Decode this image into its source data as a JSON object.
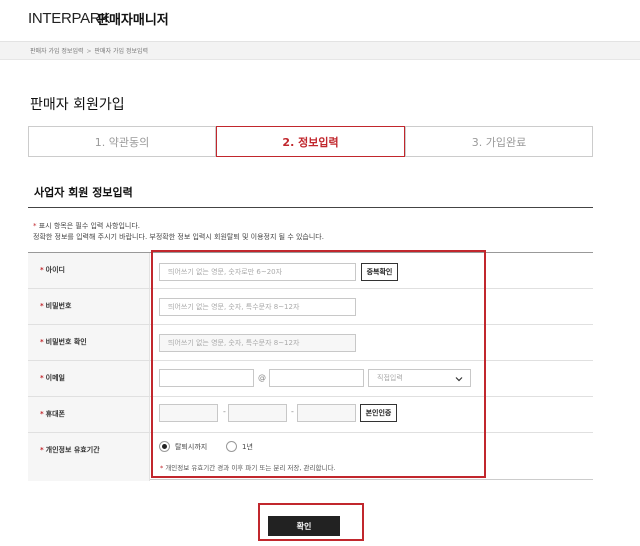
{
  "header": {
    "brand": "INTERPARK",
    "subtitle": "판매자매니저"
  },
  "breadcrumb": {
    "items": [
      "판매자 가입 정보입력",
      "판매자 가입 정보입력"
    ],
    "separator": ">"
  },
  "page": {
    "title": "판매자 회원가입"
  },
  "steps": [
    {
      "label": "1. 약관동의",
      "active": false
    },
    {
      "label": "2. 정보입력",
      "active": true
    },
    {
      "label": "3. 가입완료",
      "active": false
    }
  ],
  "section": {
    "title": "사업자 회원 정보입력"
  },
  "notice": {
    "star": "*",
    "line1": "표시 항목은 필수 입력 사항입니다.",
    "line2": "정확한 정보를 입력해 주시기 바랍니다. 부정확한 정보 입력시 회원탈퇴 및 이용정지 될 수 있습니다."
  },
  "form": {
    "required_mark": "*",
    "user_id": {
      "label": "아이디",
      "placeholder": "띄어쓰기 없는 영문, 숫자로만 6~20자",
      "button": "중복확인"
    },
    "password": {
      "label": "비밀번호",
      "placeholder": "띄어쓰기 없는 영문, 숫자, 특수문자 8~12자"
    },
    "password_confirm": {
      "label": "비밀번호 확인",
      "placeholder": "띄어쓰기 없는 영문, 숫자, 특수문자 8~12자"
    },
    "email": {
      "label": "이메일",
      "at": "@",
      "select_value": "직접입력"
    },
    "phone": {
      "label": "휴대폰",
      "dash": "-",
      "button": "본인인증"
    },
    "privacy_period": {
      "label": "개인정보 유효기간",
      "options": [
        "탈퇴시까지",
        "1년"
      ],
      "selected": "탈퇴시까지",
      "note_star": "*",
      "note": "개인정보 유효기간 경과 이후 파기 또는 분리 저장, 관리합니다."
    }
  },
  "actions": {
    "confirm": "확인"
  },
  "colors": {
    "accent": "#c1272d",
    "button_dark": "#222222"
  }
}
